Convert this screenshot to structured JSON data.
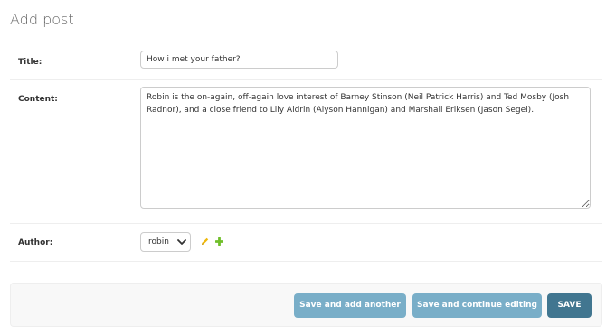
{
  "page": {
    "title": "Add post"
  },
  "form": {
    "title": {
      "label": "Title:",
      "value": "How i met your father?"
    },
    "content": {
      "label": "Content:",
      "value": "Robin is the on-again, off-again love interest of Barney Stinson (Neil Patrick Harris) and Ted Mosby (Josh Radnor), and a close friend to Lily Aldrin (Alyson Hannigan) and Marshall Eriksen (Jason Segel)."
    },
    "author": {
      "label": "Author:",
      "selected": "robin",
      "icons": [
        "pencil-icon",
        "plus-icon"
      ]
    }
  },
  "buttons": {
    "save_add_another": "Save and add another",
    "save_continue": "Save and continue editing",
    "save": "SAVE"
  },
  "colors": {
    "primary_button": "#417690",
    "secondary_button": "#79aec8",
    "edit_icon": "#efb80b",
    "add_icon": "#70bf2b"
  }
}
